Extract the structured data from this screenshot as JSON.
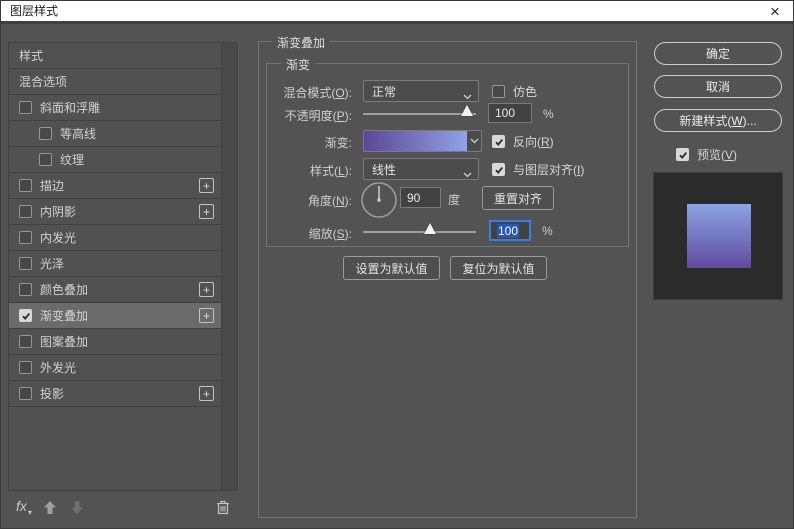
{
  "window": {
    "title": "图层样式"
  },
  "icons": {
    "close": "×",
    "plus": "+",
    "fx": "fx"
  },
  "sidebar": {
    "items": [
      {
        "label": "样式",
        "checkbox": false,
        "checked": false,
        "plus": false,
        "indent": false,
        "selected": false
      },
      {
        "label": "混合选项",
        "checkbox": false,
        "checked": false,
        "plus": false,
        "indent": false,
        "selected": false
      },
      {
        "label": "斜面和浮雕",
        "checkbox": true,
        "checked": false,
        "plus": false,
        "indent": false,
        "selected": false
      },
      {
        "label": "等高线",
        "checkbox": true,
        "checked": false,
        "plus": false,
        "indent": true,
        "selected": false
      },
      {
        "label": "纹理",
        "checkbox": true,
        "checked": false,
        "plus": false,
        "indent": true,
        "selected": false
      },
      {
        "label": "描边",
        "checkbox": true,
        "checked": false,
        "plus": true,
        "indent": false,
        "selected": false
      },
      {
        "label": "内阴影",
        "checkbox": true,
        "checked": false,
        "plus": true,
        "indent": false,
        "selected": false
      },
      {
        "label": "内发光",
        "checkbox": true,
        "checked": false,
        "plus": false,
        "indent": false,
        "selected": false
      },
      {
        "label": "光泽",
        "checkbox": true,
        "checked": false,
        "plus": false,
        "indent": false,
        "selected": false
      },
      {
        "label": "颜色叠加",
        "checkbox": true,
        "checked": false,
        "plus": true,
        "indent": false,
        "selected": false
      },
      {
        "label": "渐变叠加",
        "checkbox": true,
        "checked": true,
        "plus": true,
        "indent": false,
        "selected": true
      },
      {
        "label": "图案叠加",
        "checkbox": true,
        "checked": false,
        "plus": false,
        "indent": false,
        "selected": false
      },
      {
        "label": "外发光",
        "checkbox": true,
        "checked": false,
        "plus": false,
        "indent": false,
        "selected": false
      },
      {
        "label": "投影",
        "checkbox": true,
        "checked": false,
        "plus": true,
        "indent": false,
        "selected": false
      }
    ]
  },
  "main": {
    "group_title": "渐变叠加",
    "subgroup_title": "渐变",
    "blend_mode": {
      "pre": "混合模式(",
      "mn": "O",
      "post": "):",
      "value": "正常"
    },
    "dither": {
      "label": "仿色",
      "checked": false
    },
    "opacity": {
      "pre": "不透明度(",
      "mn": "P",
      "post": "):",
      "value": "100",
      "unit": "%"
    },
    "gradient": {
      "label": "渐变:"
    },
    "reverse": {
      "pre": "反向(",
      "mn": "R",
      "post": ")",
      "checked": true
    },
    "style": {
      "pre": "样式(",
      "mn": "L",
      "post": "):",
      "value": "线性"
    },
    "align_layer": {
      "pre": "与图层对齐(",
      "mn": "I",
      "post": ")",
      "checked": true
    },
    "angle": {
      "pre": "角度(",
      "mn": "N",
      "post": "):",
      "value": "90",
      "unit": "度"
    },
    "reset_align_button": "重置对齐",
    "scale": {
      "pre": "缩放(",
      "mn": "S",
      "post": "):",
      "value": "100",
      "unit": "%"
    },
    "set_default_button": "设置为默认值",
    "reset_default_button": "复位为默认值"
  },
  "right": {
    "ok_button": "确定",
    "cancel_button": "取消",
    "new_style": {
      "pre": "新建样式(",
      "mn": "W",
      "post": ")..."
    },
    "preview": {
      "pre": "预览(",
      "mn": "V",
      "post": ")",
      "checked": true
    }
  },
  "colors": {
    "gradient_start": "#5b4795",
    "gradient_end": "#8fa3e6",
    "preview_top": "#8ca4e3",
    "preview_bottom": "#5e4b9e",
    "focus_blue": "#3d7be8",
    "selection_blue": "#2458b8"
  }
}
